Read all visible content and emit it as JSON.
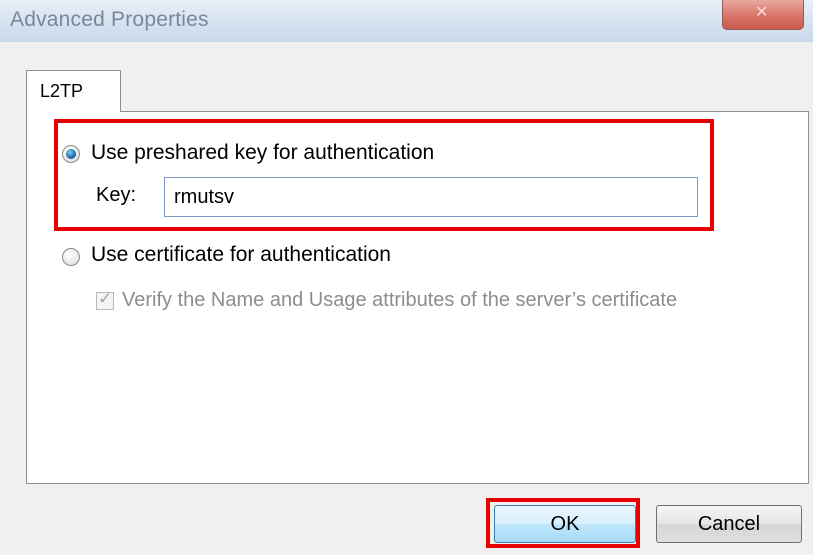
{
  "window": {
    "title": "Advanced Properties",
    "close_icon": "close-icon"
  },
  "tabs": [
    {
      "label": "L2TP",
      "selected": true
    }
  ],
  "auth": {
    "preshared_option_label": "Use preshared key for authentication",
    "preshared_selected": true,
    "key_label": "Key:",
    "key_value": "rmutsv",
    "certificate_option_label": "Use certificate for authentication",
    "certificate_selected": false,
    "verify_label": "Verify the Name and Usage attributes of the server’s certificate",
    "verify_checked": true,
    "verify_enabled": false
  },
  "buttons": {
    "ok_label": "OK",
    "cancel_label": "Cancel"
  },
  "colors": {
    "highlight": "#e60000",
    "radio_selected": "#1e6aa8",
    "ok_button": "#bee6fd"
  }
}
